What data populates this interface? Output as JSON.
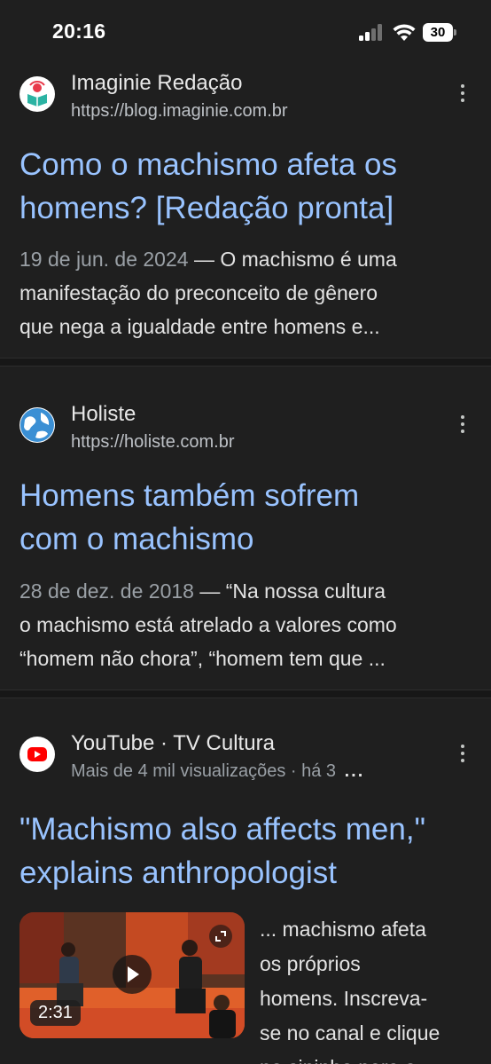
{
  "status_bar": {
    "time": "20:16",
    "battery": "30"
  },
  "results": [
    {
      "site_name": "Imaginie Redação",
      "url": "https://blog.imaginie.com.br",
      "title_line1": "Como o machismo afeta os",
      "title_line2": "homens? [Redação pronta]",
      "date": "19 de jun. de 2024",
      "snippet_line1_rest": " — O machismo é uma",
      "snippet_line2": "manifestação do preconceito de gênero",
      "snippet_line3": "que nega a igualdade entre homens e...",
      "favicon_icon": "book-reader-icon",
      "favicon_color": "#e8394a"
    },
    {
      "site_name": "Holiste",
      "url": "https://holiste.com.br",
      "title_line1": "Homens também sofrem",
      "title_line2": "com o machismo",
      "date": "28 de dez. de 2018",
      "snippet_line1_rest": " — “Na nossa cultura",
      "snippet_line2": "o machismo está atrelado a valores como",
      "snippet_line3": "“homem não chora”, “homem tem que ...",
      "favicon_icon": "globe-icon",
      "favicon_color": "#3a8fd4"
    },
    {
      "site_name": "YouTube · TV Cultura",
      "meta": "Mais de 4 mil visualizações · há 3",
      "meta_more": "...",
      "title_line1": "\"Machismo also affects men,\"",
      "title_line2": "explains anthropologist",
      "duration": "2:31",
      "snippet_lines": [
        "... machismo afeta",
        "os próprios",
        "homens. Inscreva-",
        "se no canal e clique",
        "no sininho para o"
      ],
      "favicon_icon": "youtube-icon",
      "favicon_color": "#ff0000"
    }
  ]
}
